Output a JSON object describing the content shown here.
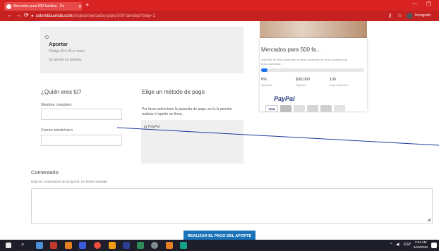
{
  "browser": {
    "tab_title": "Mercados para 500 familias · Co",
    "tab_close": "✕",
    "new_tab": "+",
    "url_domain": "colombiaunida.com",
    "url_path": "/project/mercados-para-500-familias?step=1",
    "incognito_label": "Incognito",
    "win_min": "—",
    "win_max": "❐"
  },
  "donate_option": {
    "title": "Aportar",
    "pledge": "Pledge $10.00 or more",
    "desc": "Su aporte es gratuito."
  },
  "who": {
    "heading": "¿Quién eres tú?",
    "name_label": "Nombre completo",
    "email_label": "Correo electrónico"
  },
  "payment": {
    "heading": "Elige un método de pago",
    "desc_line1": "Por favor seleccione la pasarela de pago, en la le permite",
    "desc_line2": "realizar el aporte en línea.",
    "option": "PayPal"
  },
  "campaign": {
    "title": "Mercados para 500 fa...",
    "desc_line1": "ontenido de texto contenido de texto contenido de texto contenido de",
    "desc_line2": "texto contenido...",
    "progress": 0.06,
    "stats": [
      {
        "value": "6%",
        "label": "Aportado"
      },
      {
        "value": "$30,000",
        "label": "Objetivo"
      },
      {
        "value": "135",
        "label": "Días restantes"
      }
    ]
  },
  "paypal": {
    "logo": "PayPal",
    "badges": [
      "VISA",
      "",
      "",
      "",
      "",
      ""
    ]
  },
  "comment": {
    "heading": "Comentario",
    "hint": "Deja tus comentarios de su aporte. Un breve mensaje."
  },
  "submit_label": "REALIZAR EL PAGO DEL APORTE",
  "tray": {
    "lang": "ESP",
    "time": "2:04 AM",
    "date": "6/18/2020"
  },
  "colors": {
    "chrome": "#d92323",
    "accent": "#1a73b8",
    "paypal_blue": "#253b80",
    "paypal_light": "#179bd7"
  }
}
